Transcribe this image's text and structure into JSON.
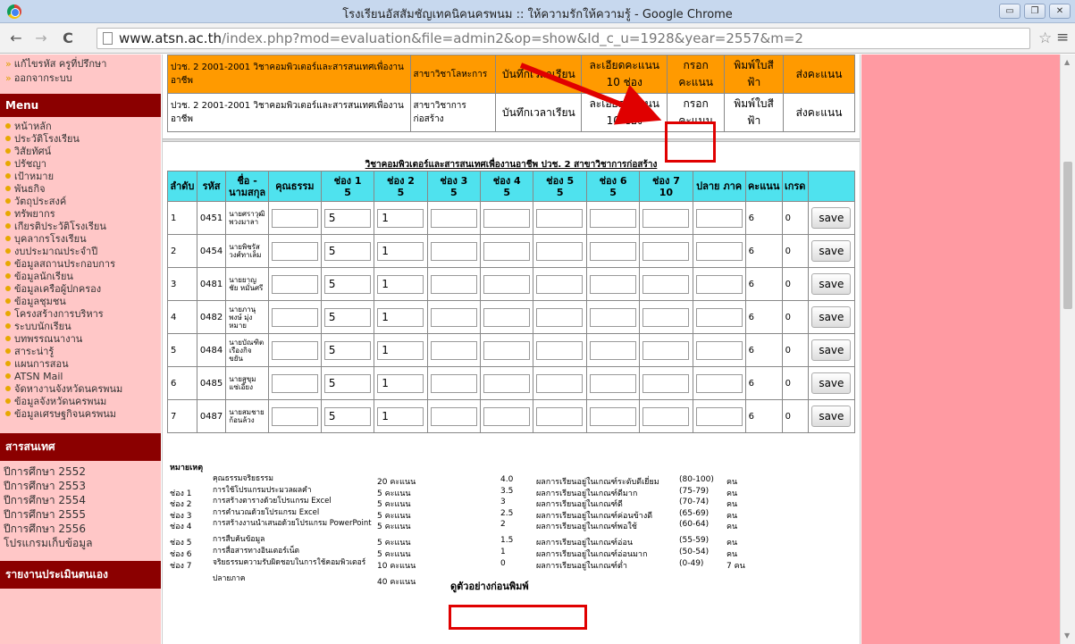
{
  "window": {
    "title": "โรงเรียนอัสสัมชัญเทคนิคนครพนม :: ให้ความรักให้ความรู้ - Google Chrome",
    "controls": [
      "▭",
      "❐",
      "✕"
    ]
  },
  "browser": {
    "back": "←",
    "forward": "→",
    "reload": "C",
    "url_host": "www.atsn.ac.th",
    "url_rest": "/index.php?mod=evaluation&file=admin2&op=show&Id_c_u=1928&year=2557&m=2",
    "star": "☆",
    "menu": "≡"
  },
  "sidebar": {
    "pre_items": [
      "แก้ไขรหัส ครูที่ปรึกษา",
      "ออกจากระบบ"
    ],
    "menu_header": "Menu",
    "menu_items": [
      "หน้าหลัก",
      "ประวัติโรงเรียน",
      "วิสัยทัศน์",
      "ปรัชญา",
      "เป้าหมาย",
      "พันธกิจ",
      "วัตถุประสงค์",
      "ทรัพยากร",
      "เกียรติประวัติโรงเรียน",
      "บุคลากรโรงเรียน",
      "งบประมาณประจำปี",
      "ข้อมูลสถานประกอบการ",
      "ข้อมูลนักเรียน",
      "ข้อมูลเครือผู้ปกครอง",
      "ข้อมูลชุมชน",
      "โครงสร้างการบริหาร",
      "ระบบนักเรียน",
      "บทพรรณนางาน",
      "สาระน่ารู้",
      "แผนการสอน",
      "ATSN Mail",
      "จัดหางานจังหวัดนครพนม",
      "ข้อมูลจังหวัดนครพนม",
      "ข้อมูลเศรษฐกิจนครพนม"
    ],
    "section_header": "สารสนเทศ",
    "years": [
      "ปีการศึกษา 2552",
      "ปีการศึกษา 2553",
      "ปีการศึกษา 2554",
      "ปีการศึกษา 2555",
      "ปีการศึกษา 2556",
      "โปรแกรมเก็บข้อมูล"
    ],
    "footer_header": "รายงานประเมินตนเอง"
  },
  "courses": [
    {
      "course": "ปวช. 2 2001-2001 วิชาคอมพิวเตอร์และสารสนเทศเพื่องานอาชีพ",
      "major": "สาขาวิชาโลหะการ",
      "time": "บันทึกเวลาเรียน",
      "detail": "ละเอียดคะแนน 10 ช่อง",
      "enter": "กรอกคะแนน",
      "print": "พิมพ์ใบสีฟ้า",
      "send": "ส่งคะแนน"
    },
    {
      "course": "ปวช. 2 2001-2001 วิชาคอมพิวเตอร์และสารสนเทศเพื่องานอาชีพ",
      "major": "สาขาวิชาการก่อสร้าง",
      "time": "บันทึกเวลาเรียน",
      "detail": "ละเอียดคะแนน 10 ช่อง",
      "enter": "กรอกคะแนน",
      "print": "พิมพ์ใบสีฟ้า",
      "send": "ส่งคะแนน"
    }
  ],
  "grid": {
    "title": "วิชาคอมพิวเตอร์และสารสนเทศเพื่องานอาชีพ ปวช. 2 สาขาวิชาการก่อสร้าง",
    "headers": {
      "no": "ลำดับ",
      "code": "รหัส",
      "name": "ชื่อ - นามสกุล",
      "ethics": "คุณธรรม",
      "c1": "ช่อง 1",
      "c1max": "5",
      "c2": "ช่อง 2",
      "c2max": "5",
      "c3": "ช่อง 3",
      "c3max": "5",
      "c4": "ช่อง 4",
      "c4max": "5",
      "c5": "ช่อง 5",
      "c5max": "5",
      "c6": "ช่อง 6",
      "c6max": "5",
      "c7": "ช่อง 7",
      "c7max": "10",
      "final": "ปลาย ภาค",
      "score": "คะแนน",
      "grade": "เกรด"
    },
    "save_label": "save",
    "rows": [
      {
        "no": "1",
        "code": "0451",
        "name": "นายศราวุฒิ พวงมาลา",
        "c1": "5",
        "c2": "1",
        "score": "6",
        "grade": "0"
      },
      {
        "no": "2",
        "code": "0454",
        "name": "นายพิชรัส วงศ์ทาเล็ม",
        "c1": "5",
        "c2": "1",
        "score": "6",
        "grade": "0"
      },
      {
        "no": "3",
        "code": "0481",
        "name": "นายยาญชัย หมั่นศรี",
        "c1": "5",
        "c2": "1",
        "score": "6",
        "grade": "0"
      },
      {
        "no": "4",
        "code": "0482",
        "name": "นายภานุพงษ์ มุ่งหมาย",
        "c1": "5",
        "c2": "1",
        "score": "6",
        "grade": "0"
      },
      {
        "no": "5",
        "code": "0484",
        "name": "นายบัณฑิต เรืองกิจขยัน",
        "c1": "5",
        "c2": "1",
        "score": "6",
        "grade": "0"
      },
      {
        "no": "6",
        "code": "0485",
        "name": "นายสุขุม แซ่เอี้ยง",
        "c1": "5",
        "c2": "1",
        "score": "6",
        "grade": "0"
      },
      {
        "no": "7",
        "code": "0487",
        "name": "นายสมชาย ก้อนล้วง",
        "c1": "5",
        "c2": "1",
        "score": "6",
        "grade": "0"
      }
    ]
  },
  "legend": {
    "title": "หมายเหตุ",
    "rows": [
      {
        "code": "",
        "desc": "คุณธรรมจริยธรรม",
        "pts": "20 คะแนน",
        "g": "4.0",
        "gdesc": "ผลการเรียนอยู่ในเกณฑ์ระดับดีเยี่ยม",
        "range": "(80-100)",
        "count": "คน"
      },
      {
        "code": "ช่อง 1",
        "desc": "การใช้โปรแกรมประมวลผลคำ",
        "pts": "5 คะแนน",
        "g": "3.5",
        "gdesc": "ผลการเรียนอยู่ในเกณฑ์ดีมาก",
        "range": "(75-79)",
        "count": "คน"
      },
      {
        "code": "ช่อง 2",
        "desc": "การสร้างตารางด้วยโปรแกรม Excel",
        "pts": "5 คะแนน",
        "g": "3",
        "gdesc": "ผลการเรียนอยู่ในเกณฑ์ดี",
        "range": "(70-74)",
        "count": "คน"
      },
      {
        "code": "ช่อง 3",
        "desc": "การคำนวณด้วยโปรแกรม Excel",
        "pts": "5 คะแนน",
        "g": "2.5",
        "gdesc": "ผลการเรียนอยู่ในเกณฑ์ค่อนข้างดี",
        "range": "(65-69)",
        "count": "คน"
      },
      {
        "code": "ช่อง 4",
        "desc": "การสร้างงานนำเสนอด้วยโปรแกรม PowerPoint",
        "pts": "5 คะแนน",
        "g": "2",
        "gdesc": "ผลการเรียนอยู่ในเกณฑ์พอใช้",
        "range": "(60-64)",
        "count": "คน"
      },
      {
        "code": "ช่อง 5",
        "desc": "การสืบค้นข้อมูล",
        "pts": "5 คะแนน",
        "g": "1.5",
        "gdesc": "ผลการเรียนอยู่ในเกณฑ์อ่อน",
        "range": "(55-59)",
        "count": "คน"
      },
      {
        "code": "ช่อง 6",
        "desc": "การสื่อสารทางอินเตอร์เน็ต",
        "pts": "5 คะแนน",
        "g": "1",
        "gdesc": "ผลการเรียนอยู่ในเกณฑ์อ่อนมาก",
        "range": "(50-54)",
        "count": "คน"
      },
      {
        "code": "ช่อง 7",
        "desc": "จริยธรรมความรับผิดชอบในการใช้คอมพิวเตอร์",
        "pts": "10 คะแนน",
        "g": "0",
        "gdesc": "ผลการเรียนอยู่ในเกณฑ์ต่ำ",
        "range": "(0-49)",
        "count": "7 คน"
      },
      {
        "code": "",
        "desc": "ปลายภาค",
        "pts": "40 คะแนน",
        "g": "",
        "gdesc": "",
        "range": "",
        "count": ""
      }
    ]
  },
  "preview_link": "ดูตัวอย่างก่อนพิมพ์",
  "colors": {
    "sidebar_bg": "#ffc7c7",
    "menu_header": "#8b0000",
    "orange_row": "#ff9a00",
    "grid_header": "#4fe2ee",
    "right_pane": "#ff9aa2",
    "annotation": "#e00000",
    "bullet": "#e8a800"
  }
}
